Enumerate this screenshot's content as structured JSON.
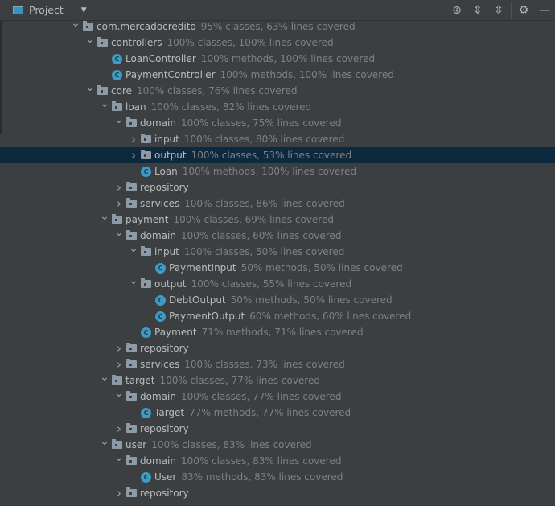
{
  "header": {
    "title": "Project",
    "tools": [
      {
        "icon": "locate-icon",
        "glyph": "⊕"
      },
      {
        "icon": "expand-all-icon",
        "glyph": "⇕"
      },
      {
        "icon": "collapse-all-icon",
        "glyph": "⇳"
      },
      {
        "icon": "gear-icon",
        "glyph": "⚙"
      },
      {
        "icon": "minimize-icon",
        "glyph": "—"
      }
    ]
  },
  "colors": {
    "background": "#3c3f41",
    "selected": "#0d293e",
    "text": "#bbbbbb",
    "hint": "#808080",
    "class_icon": "#3d9cc7"
  },
  "tree": [
    {
      "name": "com.mercadocredito",
      "hint": "95% classes, 63% lines covered",
      "depth": 0,
      "type": "folder",
      "expanded": true
    },
    {
      "name": "controllers",
      "hint": "100% classes, 100% lines covered",
      "depth": 1,
      "type": "folder",
      "expanded": true
    },
    {
      "name": "LoanController",
      "hint": "100% methods, 100% lines covered",
      "depth": 2,
      "type": "class"
    },
    {
      "name": "PaymentController",
      "hint": "100% methods, 100% lines covered",
      "depth": 2,
      "type": "class"
    },
    {
      "name": "core",
      "hint": "100% classes, 76% lines covered",
      "depth": 1,
      "type": "folder",
      "expanded": true
    },
    {
      "name": "loan",
      "hint": "100% classes, 82% lines covered",
      "depth": 2,
      "type": "folder",
      "expanded": true
    },
    {
      "name": "domain",
      "hint": "100% classes, 75% lines covered",
      "depth": 3,
      "type": "folder",
      "expanded": true
    },
    {
      "name": "input",
      "hint": "100% classes, 80% lines covered",
      "depth": 4,
      "type": "folder",
      "expanded": false
    },
    {
      "name": "output",
      "hint": "100% classes, 53% lines covered",
      "depth": 4,
      "type": "folder",
      "expanded": false,
      "selected": true
    },
    {
      "name": "Loan",
      "hint": "100% methods, 100% lines covered",
      "depth": 4,
      "type": "class"
    },
    {
      "name": "repository",
      "hint": "",
      "depth": 3,
      "type": "folder",
      "expanded": false
    },
    {
      "name": "services",
      "hint": "100% classes, 86% lines covered",
      "depth": 3,
      "type": "folder",
      "expanded": false
    },
    {
      "name": "payment",
      "hint": "100% classes, 69% lines covered",
      "depth": 2,
      "type": "folder",
      "expanded": true
    },
    {
      "name": "domain",
      "hint": "100% classes, 60% lines covered",
      "depth": 3,
      "type": "folder",
      "expanded": true
    },
    {
      "name": "input",
      "hint": "100% classes, 50% lines covered",
      "depth": 4,
      "type": "folder",
      "expanded": true
    },
    {
      "name": "PaymentInput",
      "hint": "50% methods, 50% lines covered",
      "depth": 5,
      "type": "class"
    },
    {
      "name": "output",
      "hint": "100% classes, 55% lines covered",
      "depth": 4,
      "type": "folder",
      "expanded": true
    },
    {
      "name": "DebtOutput",
      "hint": "50% methods, 50% lines covered",
      "depth": 5,
      "type": "class"
    },
    {
      "name": "PaymentOutput",
      "hint": "60% methods, 60% lines covered",
      "depth": 5,
      "type": "class"
    },
    {
      "name": "Payment",
      "hint": "71% methods, 71% lines covered",
      "depth": 4,
      "type": "class"
    },
    {
      "name": "repository",
      "hint": "",
      "depth": 3,
      "type": "folder",
      "expanded": false
    },
    {
      "name": "services",
      "hint": "100% classes, 73% lines covered",
      "depth": 3,
      "type": "folder",
      "expanded": false
    },
    {
      "name": "target",
      "hint": "100% classes, 77% lines covered",
      "depth": 2,
      "type": "folder",
      "expanded": true
    },
    {
      "name": "domain",
      "hint": "100% classes, 77% lines covered",
      "depth": 3,
      "type": "folder",
      "expanded": true
    },
    {
      "name": "Target",
      "hint": "77% methods, 77% lines covered",
      "depth": 4,
      "type": "class"
    },
    {
      "name": "repository",
      "hint": "",
      "depth": 3,
      "type": "folder",
      "expanded": false
    },
    {
      "name": "user",
      "hint": "100% classes, 83% lines covered",
      "depth": 2,
      "type": "folder",
      "expanded": true
    },
    {
      "name": "domain",
      "hint": "100% classes, 83% lines covered",
      "depth": 3,
      "type": "folder",
      "expanded": true
    },
    {
      "name": "User",
      "hint": "83% methods, 83% lines covered",
      "depth": 4,
      "type": "class"
    },
    {
      "name": "repository",
      "hint": "",
      "depth": 3,
      "type": "folder",
      "expanded": false
    }
  ]
}
